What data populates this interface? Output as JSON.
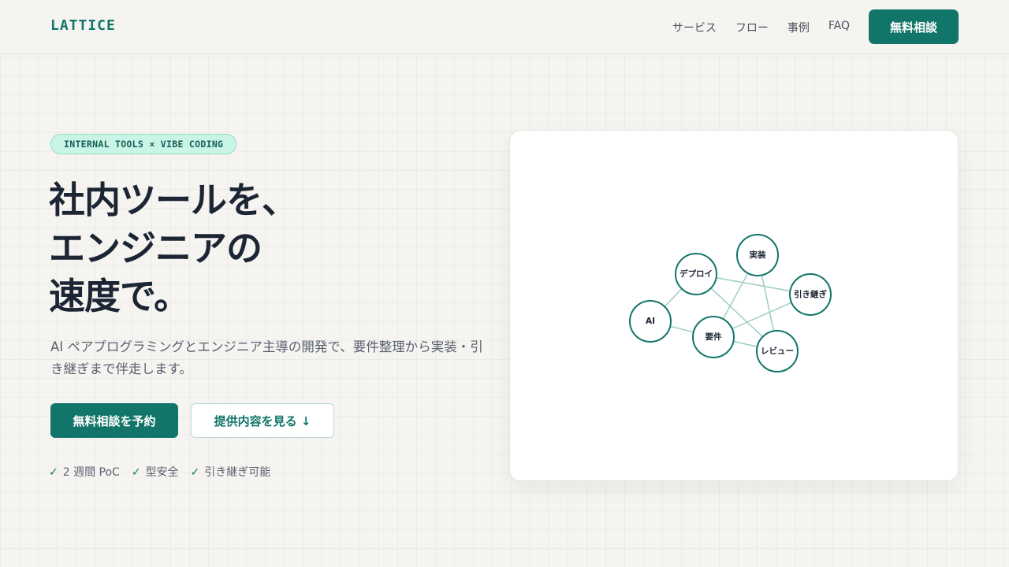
{
  "header": {
    "logo": "LATTICE",
    "nav": [
      "サービス",
      "フロー",
      "事例",
      "FAQ"
    ],
    "cta": "無料相談"
  },
  "hero": {
    "badge": "INTERNAL TOOLS × VIBE CODING",
    "title_lines": [
      "社内ツールを、",
      "エンジニアの",
      "速度で。"
    ],
    "description": "AI ペアプログラミングとエンジニア主導の開発で、要件整理から実装・引き継ぎまで伴走します。",
    "primary_button": "無料相談を予約",
    "secondary_button": "提供内容を見る ↓",
    "features": [
      "2 週間 PoC",
      "型安全",
      "引き継ぎ可能"
    ]
  },
  "graph": {
    "nodes": [
      "AI",
      "デプロイ",
      "実装",
      "引き継ぎ",
      "要件",
      "レビュー"
    ]
  },
  "colors": {
    "accent": "#12756a",
    "badge_bg": "#c9f4e6",
    "background": "#f5f4f0"
  }
}
